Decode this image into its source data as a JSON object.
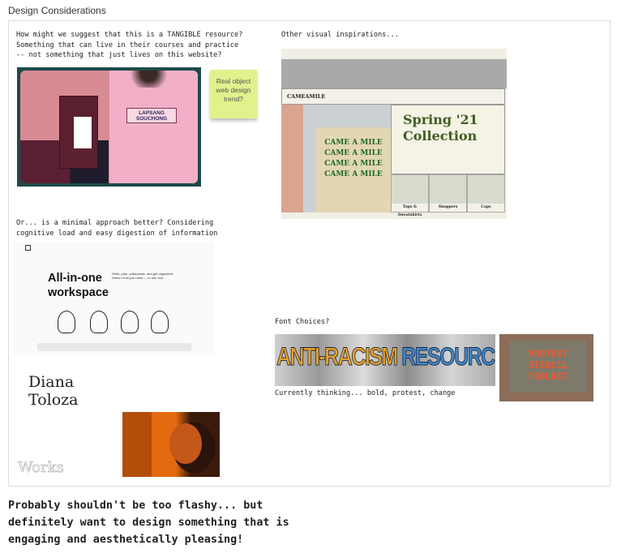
{
  "header": {
    "title": "Design Considerations"
  },
  "board": {
    "tangible": {
      "question": "How might we suggest that this is a TANGIBLE resource?\nSomething that can live in their courses and practice\n-- not something that just lives on this website?",
      "image_label": "LAPSANG SOUCHONG",
      "sticky_note": "Real object web design trend?"
    },
    "inspiration": {
      "heading": "Other visual inspirations...",
      "brand": "CAMEAMILE",
      "hero_title": "Spring '21\nCollection",
      "bag_text": "CAME A MILE\nCAME A MILE\nCAME A MILE\nCAME A MILE",
      "tiles": [
        "Tops & Sweatshirts",
        "Shoppers",
        "Caps"
      ]
    },
    "minimal": {
      "question": "Or... is a minimal approach better? Considering\ncognitive load and easy digestion of information",
      "notion_heading": "All-in-one\nworkspace",
      "notion_sub": "Write, plan, collaborate, and get organized. Notion is all you need — in one tool.",
      "portfolio_name": "Diana\nToloza",
      "portfolio_works": "Works"
    },
    "fonts": {
      "heading": "Font Choices?",
      "banner_word1": "ANTI-RACISM",
      "banner_word2": "RESOURCES",
      "caption": "Currently thinking... bold, protest, change",
      "stencil_text": "PROTEST\nSTENCIL\nTOOLKIT"
    }
  },
  "footer": {
    "note": "Probably shouldn't be too flashy... but\ndefinitely want to design something that is\nengaging and aesthetically pleasing!"
  },
  "colors": {
    "sticky": "#e2f18c",
    "stencil": "#f0582e",
    "banner_orange": "#e5a126",
    "banner_blue": "#3f86c6"
  }
}
